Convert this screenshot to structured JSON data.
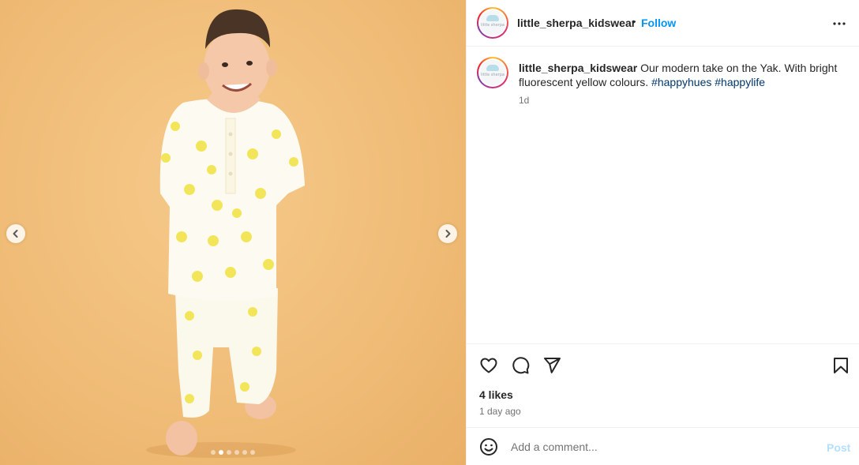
{
  "post": {
    "username": "little_sherpa_kidswear",
    "separator": "•",
    "follow_label": "Follow",
    "caption_text": " Our modern take on the Yak. With bright fluorescent yellow colours. ",
    "hashtags": [
      "#happyhues",
      "#happylife"
    ],
    "caption_time": "1d",
    "likes": "4 likes",
    "posted_ago": "1 day ago",
    "avatar_logo_text": "little sherpa"
  },
  "comment": {
    "placeholder": "Add a comment...",
    "post_label": "Post"
  },
  "carousel": {
    "slide_count": 6,
    "active_index": 1
  },
  "icons": {
    "prev": "chevron-left-icon",
    "next": "chevron-right-icon",
    "more": "more-options-icon",
    "like": "heart-icon",
    "comment": "comment-icon",
    "share": "paper-plane-icon",
    "save": "bookmark-icon",
    "emoji": "emoji-icon"
  },
  "colors": {
    "follow": "#0095f6",
    "hashtag": "#00376b",
    "post_disabled": "#b3dffc",
    "background_photo": "#f0bd78"
  }
}
